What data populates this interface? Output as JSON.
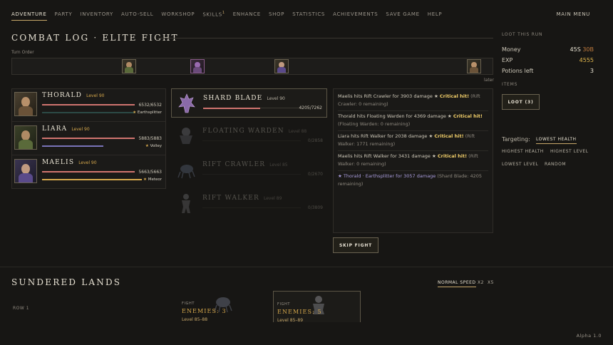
{
  "nav": {
    "items": [
      "ADVENTURE",
      "PARTY",
      "INVENTORY",
      "AUTO-SELL",
      "WORKSHOP",
      "SKILLS",
      "ENHANCE",
      "SHOP",
      "STATISTICS",
      "ACHIEVEMENTS",
      "SAVE GAME",
      "HELP"
    ],
    "skills_badge": "1",
    "active": "ADVENTURE",
    "main_menu": "MAIN MENU"
  },
  "combat": {
    "title": "COMBAT LOG · ELITE FIGHT",
    "turn_order_label": "Turn Order",
    "turn_later_label": "later"
  },
  "party": [
    {
      "name": "THORALD",
      "level": "Level 90",
      "hp": "6532/6532",
      "skill": "Earthsplitter",
      "hp_fraction": 1.0,
      "sub_color": "#3f6e66"
    },
    {
      "name": "LIARA",
      "level": "Level 90",
      "hp": "5883/5883",
      "skill": "Volley",
      "hp_fraction": 1.0,
      "sub_color": "#7a74b8"
    },
    {
      "name": "MAELIS",
      "level": "Level 90",
      "hp": "5663/5663",
      "skill": "Meteor",
      "hp_fraction": 1.0,
      "sub_color": "#d6a84c"
    }
  ],
  "enemies": [
    {
      "name": "SHARD BLADE",
      "level": "Level 90",
      "hp": "4205/7262",
      "hp_fraction": 0.579,
      "alive": true
    },
    {
      "name": "FLOATING WARDEN",
      "level": "Level 88",
      "hp": "0/2858",
      "hp_fraction": 0,
      "alive": false
    },
    {
      "name": "RIFT CRAWLER",
      "level": "Level 85",
      "hp": "0/2670",
      "hp_fraction": 0,
      "alive": false
    },
    {
      "name": "RIFT WALKER",
      "level": "Level 89",
      "hp": "0/3809",
      "hp_fraction": 0,
      "alive": false
    }
  ],
  "log": {
    "lines": [
      {
        "text": "Maelis hits Rift Crawler for 3903 damage ★ ",
        "crit": "Critical hit!",
        "dim": " (Rift Crawler: 0 remaining)"
      },
      {
        "text": "Thorald hits Floating Warden for 4369 damage ★ ",
        "crit": "Critical hit!",
        "dim": " (Floating Warden: 0 remaining)"
      },
      {
        "text": "Liara hits Rift Walker for 2038 damage ★ ",
        "crit": "Critical hit!",
        "dim": " (Rift Walker: 1771 remaining)"
      },
      {
        "text": "Maelis hits Rift Walker for 3431 damage ★ ",
        "crit": "Critical hit!",
        "dim": " (Rift Walker: 0 remaining)"
      },
      {
        "text": "★ Thorald · Earthsplitter for 3057 damage",
        "crit": "",
        "dim": " (Shard Blade: 4205 remaining)"
      }
    ]
  },
  "skip_fight": "SKIP FIGHT",
  "loot": {
    "title": "LOOT THIS RUN",
    "money_label": "Money",
    "money_silver": "45S",
    "money_bronze": "30B",
    "exp_label": "EXP",
    "exp_value": "4555",
    "potions_label": "Potions left",
    "potions_value": "3",
    "items_label": "ITEMS",
    "loot_button": "LOOT (3)"
  },
  "targeting": {
    "label": "Targeting:",
    "options": [
      "LOWEST HEALTH",
      "HIGHEST HEALTH",
      "HIGHEST LEVEL",
      "LOWEST LEVEL",
      "RANDOM"
    ],
    "active": "LOWEST HEALTH"
  },
  "lands": {
    "title": "SUNDERED LANDS",
    "speeds": [
      "NORMAL SPEED",
      "X2",
      "X5"
    ],
    "active_speed": "NORMAL SPEED",
    "row_label": "ROW 1",
    "fights": [
      {
        "tag": "FIGHT",
        "enemies": "ENEMIES: 3",
        "level": "Level 85–88"
      },
      {
        "tag": "FIGHT",
        "enemies": "ENEMIES: 5",
        "level": "Level 85–89"
      }
    ]
  },
  "version": "Alpha 1.0",
  "colors": {
    "accent_gold": "#d6a84c",
    "crit": "#f2cf6a",
    "hp_bar": "#d0746f",
    "skill_purple": "#a99cdc"
  }
}
